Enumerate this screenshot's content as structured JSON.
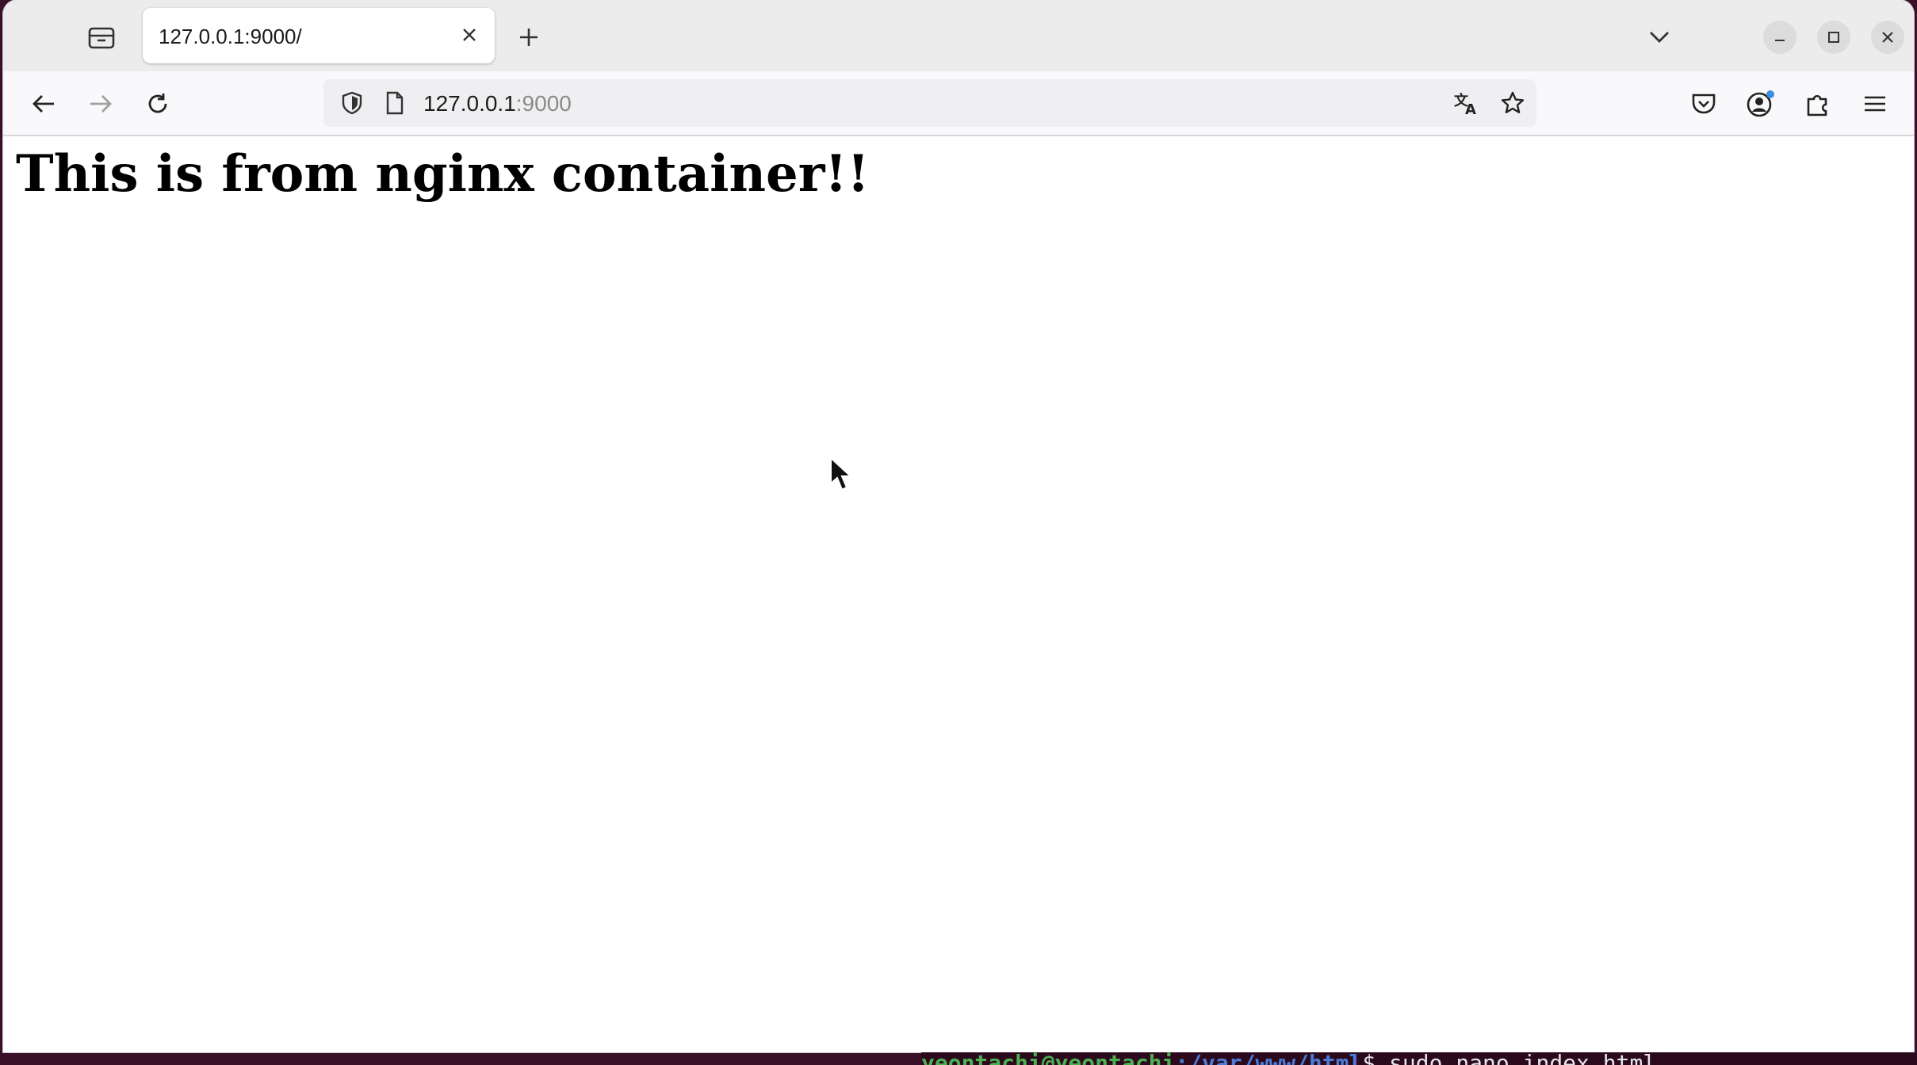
{
  "browser": {
    "tab": {
      "title": "127.0.0.1:9000/"
    },
    "address_bar": {
      "host": "127.0.0.1",
      "port": ":9000"
    },
    "icons": {
      "tab_list": "tab-list-icon",
      "close_tab": "close-icon",
      "new_tab": "plus-icon",
      "tab_overflow": "chevron-down-icon",
      "minimize": "minimize-icon",
      "maximize": "maximize-icon",
      "close_window": "close-icon",
      "back": "arrow-left-icon",
      "forward": "arrow-right-icon",
      "reload": "reload-icon",
      "shield": "shield-icon",
      "page": "page-icon",
      "translate": "translate-icon",
      "bookmark": "star-icon",
      "pocket": "pocket-icon",
      "account": "account-icon",
      "extensions": "puzzle-icon",
      "menu": "hamburger-icon"
    }
  },
  "page": {
    "heading": "This is from nginx container!!"
  },
  "terminal": {
    "user": "yeontachi@yeontachi",
    "path": ":/var/www/html",
    "command": "$ sudo nano index.html"
  },
  "colors": {
    "tabstrip": "#ececec",
    "navbar": "#f9f9fb",
    "urlbar": "#efeff2",
    "desktop": "#3a0f2a"
  }
}
